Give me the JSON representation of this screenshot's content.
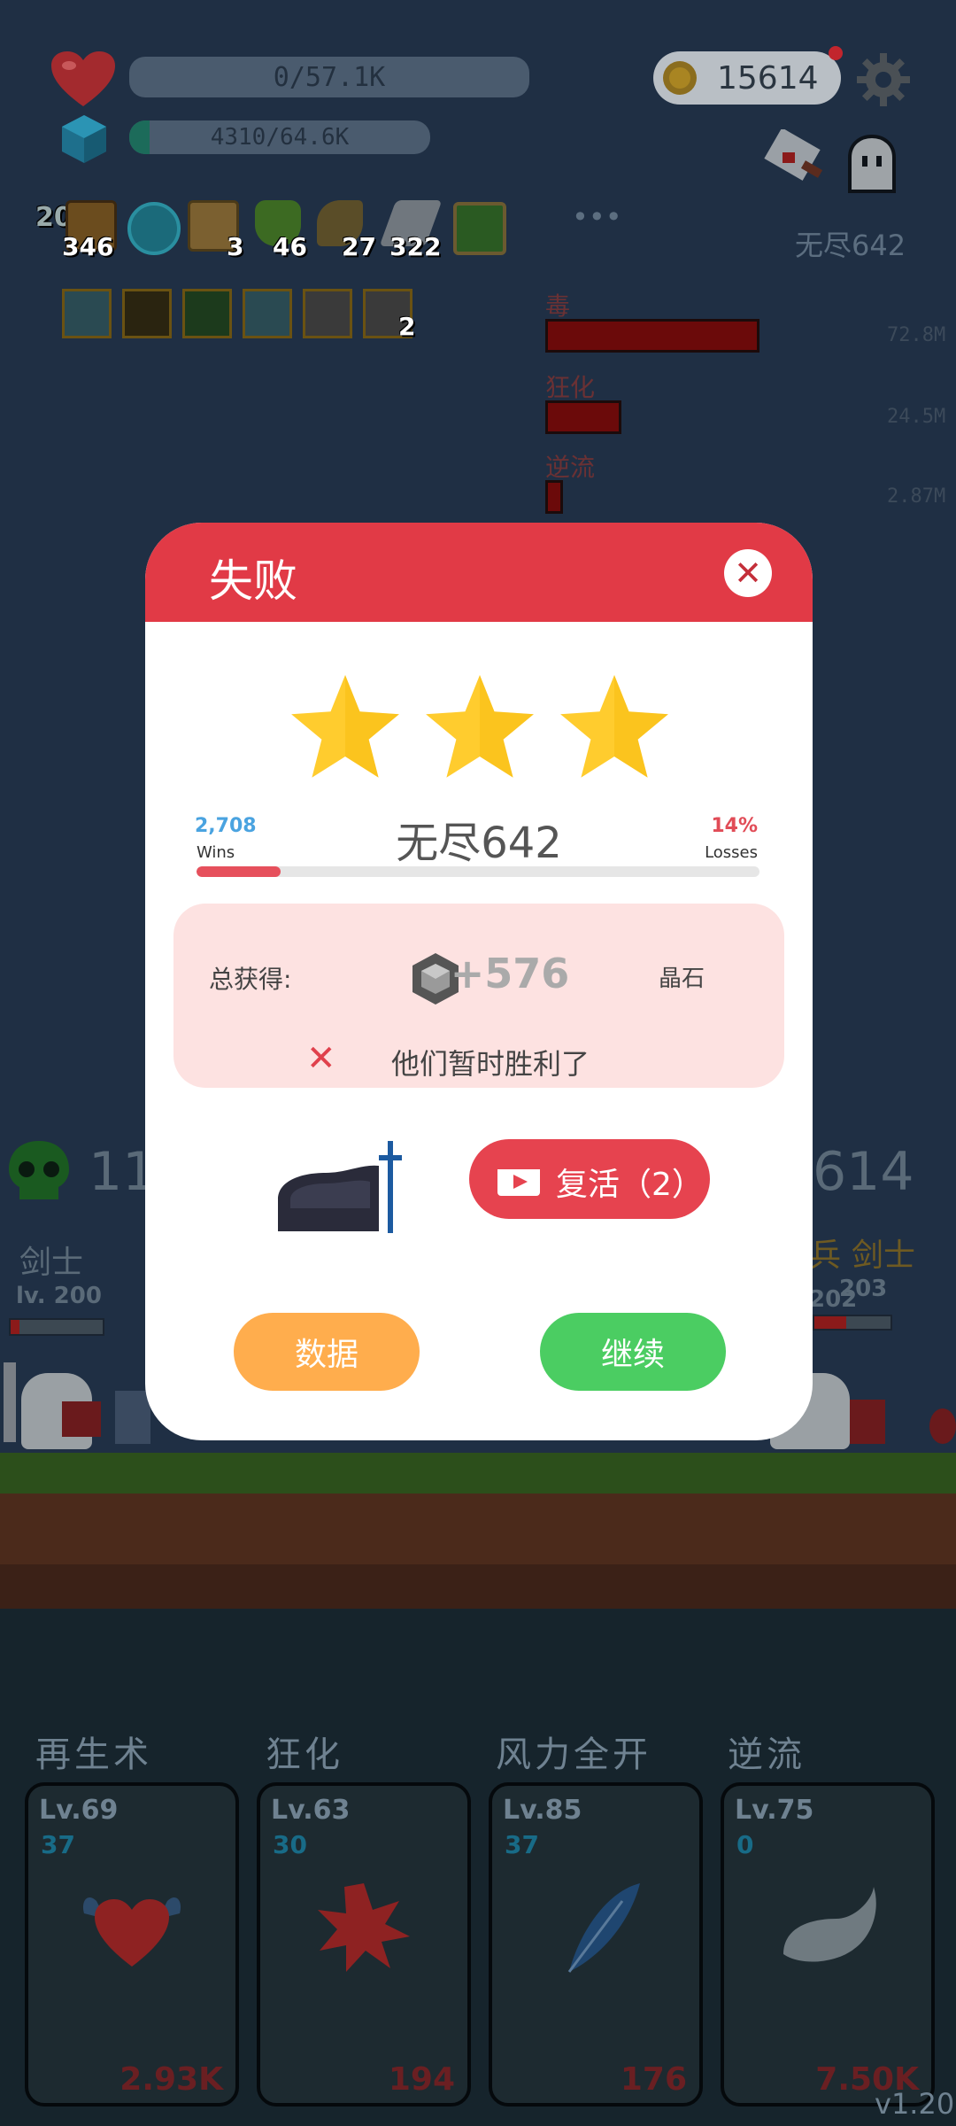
{
  "hud": {
    "hp_text": "0/57.1K",
    "hp_fill": 0,
    "mana_text": "4310/64.6K",
    "mana_fill": 0.067,
    "coins": "15614",
    "stage_label": "无尽642",
    "more": "•••",
    "items": [
      {
        "name": "chest",
        "count": "346",
        "badge": "20"
      },
      {
        "name": "target",
        "count": ""
      },
      {
        "name": "scroll",
        "count": "3"
      },
      {
        "name": "potion",
        "count": "46"
      },
      {
        "name": "bow",
        "count": "27"
      },
      {
        "name": "sword",
        "count": "322"
      },
      {
        "name": "book",
        "count": ""
      }
    ],
    "buff_extra": "2"
  },
  "damage": [
    {
      "label": "毒",
      "value": "72.8M",
      "fill": 1.0
    },
    {
      "label": "狂化",
      "value": "24.5M",
      "fill": 0.34
    },
    {
      "label": "逆流",
      "value": "2.87M",
      "fill": 0.04
    }
  ],
  "battle": {
    "left_count": "11",
    "right_count": "614",
    "left_class": "剑士",
    "left_level": "lv. 200",
    "right_class": "剑士",
    "right_prefix": "兵",
    "right_level_a": "203",
    "right_level_b": "202"
  },
  "modal": {
    "title": "失败",
    "stars": 3,
    "stage": "无尽642",
    "wins_num": "2,708",
    "wins_label": "Wins",
    "loss_num": "14%",
    "loss_label": "Losses",
    "progress": 0.15,
    "reward_label": "总获得:",
    "reward_amount": "+576",
    "reward_unit": "晶石",
    "reward_message": "他们暂时胜利了",
    "revive_label": "复活（2）",
    "stats_button": "数据",
    "continue_button": "继续"
  },
  "skills": [
    {
      "title": "再生术",
      "level": "Lv.69",
      "sub": "37",
      "cost": "2.93K",
      "icon": "winged-heart-icon"
    },
    {
      "title": "狂化",
      "level": "Lv.63",
      "sub": "30",
      "cost": "194",
      "icon": "rage-splash-icon"
    },
    {
      "title": "风力全开",
      "level": "Lv.85",
      "sub": "37",
      "cost": "176",
      "icon": "feather-icon"
    },
    {
      "title": "逆流",
      "level": "Lv.75",
      "sub": "0",
      "cost": "7.50K",
      "icon": "wing-icon"
    }
  ],
  "version": "v1.20",
  "colors": {
    "modal_header": "#e13a46",
    "revive": "#e6434f",
    "stats_button": "#ffad4d",
    "continue_button": "#4bcd62",
    "star": "#ffcc2e"
  }
}
